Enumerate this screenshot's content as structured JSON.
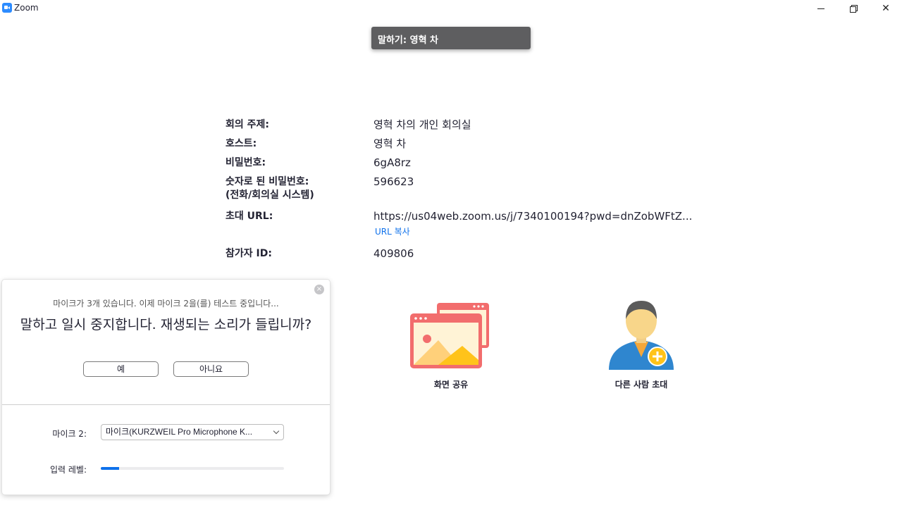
{
  "window": {
    "title": "Zoom",
    "controls": {
      "minimize_icon": "minimize-icon",
      "maximize_icon": "restore-icon",
      "close_glyph": "✕"
    }
  },
  "speaking": {
    "label": "말하기: 영혁 차"
  },
  "meeting": {
    "rows": [
      {
        "label": "회의 주제:",
        "value": "영혁 차의 개인 회의실"
      },
      {
        "label": "호스트:",
        "value": "영혁 차"
      },
      {
        "label": "비밀번호:",
        "value": "6gA8rz"
      },
      {
        "label_line1": "숫자로 된 비밀번호:",
        "label_line2": "(전화/회의실 시스템)",
        "value": "596623"
      },
      {
        "label": "초대 URL:",
        "value": "https://us04web.zoom.us/j/7340100194?pwd=dnZobWFtZ...",
        "action": "URL 복사"
      },
      {
        "label": "참가자 ID:",
        "value": "409806"
      }
    ]
  },
  "actions": {
    "share_screen": "화면 공유",
    "invite_others": "다른 사람 초대"
  },
  "audio_test": {
    "close_glyph": "×",
    "status": "마이크가 3개 있습니다. 이제 마이크 2을(를) 테스트 중입니다...",
    "question": "말하고 일시 중지합니다. 재생되는 소리가 들립니까?",
    "yes": "예",
    "no": "아니요",
    "mic_label": "마이크 2:",
    "mic_value": "마이크(KURZWEIL Pro Microphone K...",
    "level_label": "입력 레벨:",
    "level_fraction": 0.1
  },
  "colors": {
    "accent": "#0e71eb",
    "share_icon": "#f26d6d",
    "invite_icon_body": "#2f86cf",
    "invite_badge": "#ffc31a"
  }
}
